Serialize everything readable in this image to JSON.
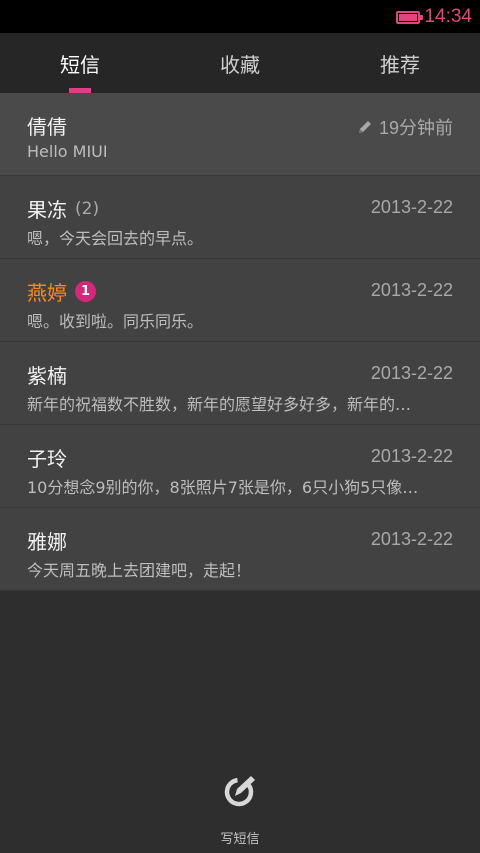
{
  "status_bar": {
    "time": "14:34"
  },
  "tabs": [
    {
      "label": "短信",
      "active": true
    },
    {
      "label": "收藏",
      "active": false
    },
    {
      "label": "推荐",
      "active": false
    }
  ],
  "messages": [
    {
      "name": "倩倩",
      "count": "",
      "badge": "",
      "date": "19分钟前",
      "draft": true,
      "preview": "Hello MIUI",
      "unread": false
    },
    {
      "name": "果冻",
      "count": "(2)",
      "badge": "",
      "date": "2013-2-22",
      "draft": false,
      "preview": "嗯，今天会回去的早点。",
      "unread": false
    },
    {
      "name": "燕婷",
      "count": "",
      "badge": "1",
      "date": "2013-2-22",
      "draft": false,
      "preview": "嗯。收到啦。同乐同乐。",
      "unread": true
    },
    {
      "name": "紫楠",
      "count": "",
      "badge": "",
      "date": "2013-2-22",
      "draft": false,
      "preview": "新年的祝福数不胜数，新年的愿望好多好多，新年的…",
      "unread": false
    },
    {
      "name": "子玲",
      "count": "",
      "badge": "",
      "date": "2013-2-22",
      "draft": false,
      "preview": "10分想念9别的你，8张照片7张是你，6只小狗5只像…",
      "unread": false
    },
    {
      "name": "雅娜",
      "count": "",
      "badge": "",
      "date": "2013-2-22",
      "draft": false,
      "preview": "今天周五晚上去团建吧，走起！",
      "unread": false
    }
  ],
  "compose": {
    "label": "写短信",
    "icon": "compose-icon"
  },
  "colors": {
    "accent": "#e03f85",
    "unread_name": "#ff8a1c",
    "badge": "#d6287a"
  }
}
